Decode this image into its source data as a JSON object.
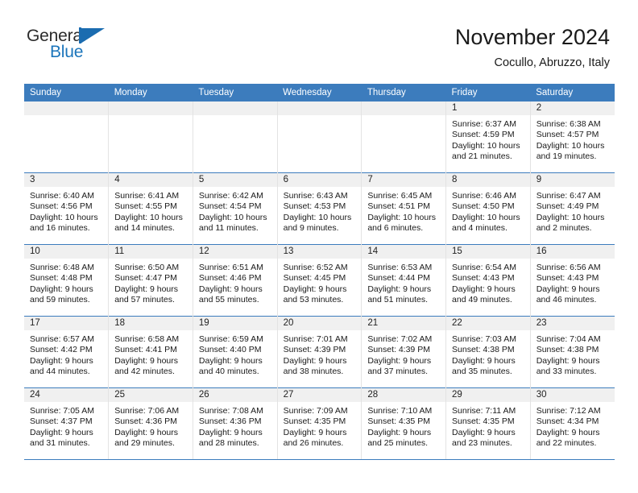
{
  "brand": {
    "name_part1": "General",
    "name_part2": "Blue",
    "flag_icon": "triangle-flag-icon"
  },
  "header": {
    "month_title": "November 2024",
    "location": "Cocullo, Abruzzo, Italy"
  },
  "colors": {
    "header_blue": "#3c7cbd",
    "daynum_strip": "#f0f0f0",
    "brand_blue": "#1b75bb",
    "text": "#1a1a1a"
  },
  "calendar": {
    "weekdays": [
      "Sunday",
      "Monday",
      "Tuesday",
      "Wednesday",
      "Thursday",
      "Friday",
      "Saturday"
    ],
    "labels": {
      "sunrise": "Sunrise:",
      "sunset": "Sunset:",
      "daylight": "Daylight:"
    },
    "weeks": [
      [
        {
          "day": "",
          "empty": true
        },
        {
          "day": "",
          "empty": true
        },
        {
          "day": "",
          "empty": true
        },
        {
          "day": "",
          "empty": true
        },
        {
          "day": "",
          "empty": true
        },
        {
          "day": "1",
          "sunrise": "Sunrise: 6:37 AM",
          "sunset": "Sunset: 4:59 PM",
          "daylight": "Daylight: 10 hours and 21 minutes."
        },
        {
          "day": "2",
          "sunrise": "Sunrise: 6:38 AM",
          "sunset": "Sunset: 4:57 PM",
          "daylight": "Daylight: 10 hours and 19 minutes."
        }
      ],
      [
        {
          "day": "3",
          "sunrise": "Sunrise: 6:40 AM",
          "sunset": "Sunset: 4:56 PM",
          "daylight": "Daylight: 10 hours and 16 minutes."
        },
        {
          "day": "4",
          "sunrise": "Sunrise: 6:41 AM",
          "sunset": "Sunset: 4:55 PM",
          "daylight": "Daylight: 10 hours and 14 minutes."
        },
        {
          "day": "5",
          "sunrise": "Sunrise: 6:42 AM",
          "sunset": "Sunset: 4:54 PM",
          "daylight": "Daylight: 10 hours and 11 minutes."
        },
        {
          "day": "6",
          "sunrise": "Sunrise: 6:43 AM",
          "sunset": "Sunset: 4:53 PM",
          "daylight": "Daylight: 10 hours and 9 minutes."
        },
        {
          "day": "7",
          "sunrise": "Sunrise: 6:45 AM",
          "sunset": "Sunset: 4:51 PM",
          "daylight": "Daylight: 10 hours and 6 minutes."
        },
        {
          "day": "8",
          "sunrise": "Sunrise: 6:46 AM",
          "sunset": "Sunset: 4:50 PM",
          "daylight": "Daylight: 10 hours and 4 minutes."
        },
        {
          "day": "9",
          "sunrise": "Sunrise: 6:47 AM",
          "sunset": "Sunset: 4:49 PM",
          "daylight": "Daylight: 10 hours and 2 minutes."
        }
      ],
      [
        {
          "day": "10",
          "sunrise": "Sunrise: 6:48 AM",
          "sunset": "Sunset: 4:48 PM",
          "daylight": "Daylight: 9 hours and 59 minutes."
        },
        {
          "day": "11",
          "sunrise": "Sunrise: 6:50 AM",
          "sunset": "Sunset: 4:47 PM",
          "daylight": "Daylight: 9 hours and 57 minutes."
        },
        {
          "day": "12",
          "sunrise": "Sunrise: 6:51 AM",
          "sunset": "Sunset: 4:46 PM",
          "daylight": "Daylight: 9 hours and 55 minutes."
        },
        {
          "day": "13",
          "sunrise": "Sunrise: 6:52 AM",
          "sunset": "Sunset: 4:45 PM",
          "daylight": "Daylight: 9 hours and 53 minutes."
        },
        {
          "day": "14",
          "sunrise": "Sunrise: 6:53 AM",
          "sunset": "Sunset: 4:44 PM",
          "daylight": "Daylight: 9 hours and 51 minutes."
        },
        {
          "day": "15",
          "sunrise": "Sunrise: 6:54 AM",
          "sunset": "Sunset: 4:43 PM",
          "daylight": "Daylight: 9 hours and 49 minutes."
        },
        {
          "day": "16",
          "sunrise": "Sunrise: 6:56 AM",
          "sunset": "Sunset: 4:43 PM",
          "daylight": "Daylight: 9 hours and 46 minutes."
        }
      ],
      [
        {
          "day": "17",
          "sunrise": "Sunrise: 6:57 AM",
          "sunset": "Sunset: 4:42 PM",
          "daylight": "Daylight: 9 hours and 44 minutes."
        },
        {
          "day": "18",
          "sunrise": "Sunrise: 6:58 AM",
          "sunset": "Sunset: 4:41 PM",
          "daylight": "Daylight: 9 hours and 42 minutes."
        },
        {
          "day": "19",
          "sunrise": "Sunrise: 6:59 AM",
          "sunset": "Sunset: 4:40 PM",
          "daylight": "Daylight: 9 hours and 40 minutes."
        },
        {
          "day": "20",
          "sunrise": "Sunrise: 7:01 AM",
          "sunset": "Sunset: 4:39 PM",
          "daylight": "Daylight: 9 hours and 38 minutes."
        },
        {
          "day": "21",
          "sunrise": "Sunrise: 7:02 AM",
          "sunset": "Sunset: 4:39 PM",
          "daylight": "Daylight: 9 hours and 37 minutes."
        },
        {
          "day": "22",
          "sunrise": "Sunrise: 7:03 AM",
          "sunset": "Sunset: 4:38 PM",
          "daylight": "Daylight: 9 hours and 35 minutes."
        },
        {
          "day": "23",
          "sunrise": "Sunrise: 7:04 AM",
          "sunset": "Sunset: 4:38 PM",
          "daylight": "Daylight: 9 hours and 33 minutes."
        }
      ],
      [
        {
          "day": "24",
          "sunrise": "Sunrise: 7:05 AM",
          "sunset": "Sunset: 4:37 PM",
          "daylight": "Daylight: 9 hours and 31 minutes."
        },
        {
          "day": "25",
          "sunrise": "Sunrise: 7:06 AM",
          "sunset": "Sunset: 4:36 PM",
          "daylight": "Daylight: 9 hours and 29 minutes."
        },
        {
          "day": "26",
          "sunrise": "Sunrise: 7:08 AM",
          "sunset": "Sunset: 4:36 PM",
          "daylight": "Daylight: 9 hours and 28 minutes."
        },
        {
          "day": "27",
          "sunrise": "Sunrise: 7:09 AM",
          "sunset": "Sunset: 4:35 PM",
          "daylight": "Daylight: 9 hours and 26 minutes."
        },
        {
          "day": "28",
          "sunrise": "Sunrise: 7:10 AM",
          "sunset": "Sunset: 4:35 PM",
          "daylight": "Daylight: 9 hours and 25 minutes."
        },
        {
          "day": "29",
          "sunrise": "Sunrise: 7:11 AM",
          "sunset": "Sunset: 4:35 PM",
          "daylight": "Daylight: 9 hours and 23 minutes."
        },
        {
          "day": "30",
          "sunrise": "Sunrise: 7:12 AM",
          "sunset": "Sunset: 4:34 PM",
          "daylight": "Daylight: 9 hours and 22 minutes."
        }
      ]
    ]
  }
}
